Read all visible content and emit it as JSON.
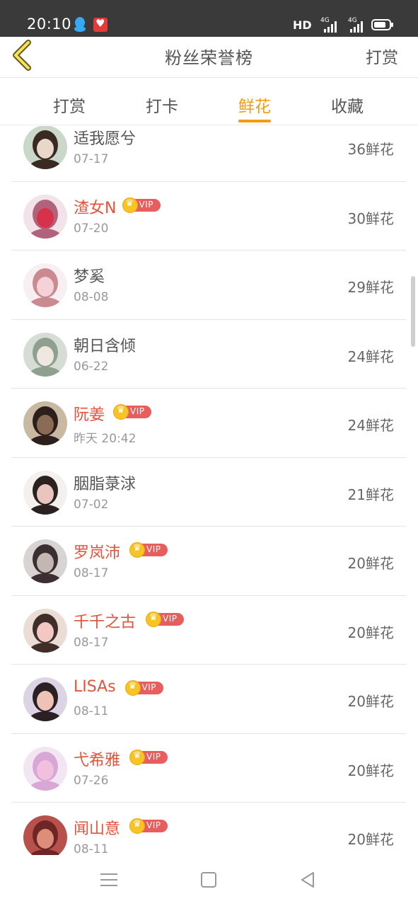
{
  "status_bar": {
    "time": "20:10",
    "hd": "HD",
    "network_1": "4G",
    "network_2": "4G",
    "icons": [
      "qq-icon",
      "app-notification-icon",
      "signal-icon",
      "battery-icon"
    ]
  },
  "header": {
    "title": "粉丝荣誉榜",
    "right_link": "打赏",
    "back_icon": "chevron-left-icon"
  },
  "tabs": [
    {
      "label": "打赏",
      "active": false
    },
    {
      "label": "打卡",
      "active": false
    },
    {
      "label": "鲜花",
      "active": true
    },
    {
      "label": "收藏",
      "active": false
    }
  ],
  "vip_label": "VIP",
  "colors": {
    "accent": "#f39c12",
    "vip_name": "#e4533a",
    "vip_badge": "#e85d5d",
    "crown": "#f7c325"
  },
  "rows": [
    {
      "name": "适我愿兮",
      "date": "07-17",
      "flowers": "36鲜花",
      "vip": false
    },
    {
      "name": "渣女N",
      "date": "07-20",
      "flowers": "30鲜花",
      "vip": true
    },
    {
      "name": "梦奚",
      "date": "08-08",
      "flowers": "29鲜花",
      "vip": false
    },
    {
      "name": "朝日含倾",
      "date": "06-22",
      "flowers": "24鲜花",
      "vip": false
    },
    {
      "name": "阮姜",
      "date": "昨天 20:42",
      "flowers": "24鲜花",
      "vip": true
    },
    {
      "name": "胭脂菉浗",
      "date": "07-02",
      "flowers": "21鲜花",
      "vip": false
    },
    {
      "name": "罗岚沛",
      "date": "08-17",
      "flowers": "20鲜花",
      "vip": true
    },
    {
      "name": "千千之古",
      "date": "08-17",
      "flowers": "20鲜花",
      "vip": true
    },
    {
      "name": "LISAs",
      "date": "08-11",
      "flowers": "20鲜花",
      "vip": true
    },
    {
      "name": "弋希雅",
      "date": "07-26",
      "flowers": "20鲜花",
      "vip": true
    },
    {
      "name": "闻山意",
      "date": "08-11",
      "flowers": "20鲜花",
      "vip": true
    }
  ],
  "nav_bar": {
    "icons": [
      "menu-icon",
      "home-icon",
      "back-triangle-icon"
    ]
  }
}
